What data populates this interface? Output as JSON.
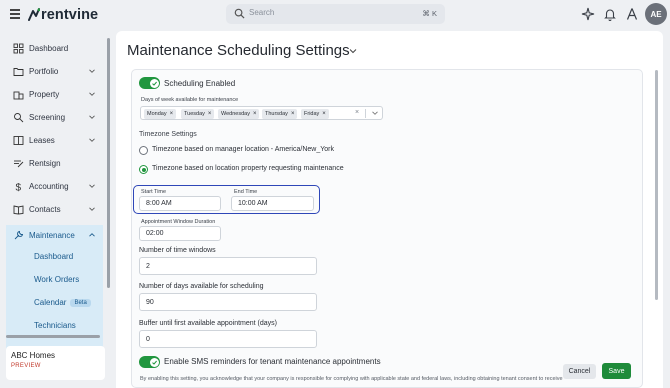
{
  "header": {
    "brand": "rentvine",
    "search_placeholder": "Search",
    "search_shortcut": "⌘ K",
    "avatar_initials": "AE"
  },
  "sidebar": {
    "items": [
      {
        "label": "Dashboard",
        "icon": "dashboard-icon"
      },
      {
        "label": "Portfolio",
        "icon": "portfolio-icon"
      },
      {
        "label": "Property",
        "icon": "property-icon"
      },
      {
        "label": "Screening",
        "icon": "screening-icon"
      },
      {
        "label": "Leases",
        "icon": "leases-icon"
      },
      {
        "label": "Rentsign",
        "icon": "rentsign-icon"
      },
      {
        "label": "Accounting",
        "icon": "accounting-icon"
      },
      {
        "label": "Contacts",
        "icon": "contacts-icon"
      },
      {
        "label": "Maintenance",
        "icon": "maintenance-icon"
      }
    ],
    "maintenance_sub": [
      {
        "label": "Dashboard"
      },
      {
        "label": "Work Orders"
      },
      {
        "label": "Calendar",
        "badge": "Beta"
      },
      {
        "label": "Technicians"
      }
    ],
    "company_name": "ABC Homes",
    "company_tag": "PREVIEW"
  },
  "page": {
    "title": "Maintenance Scheduling Settings"
  },
  "form": {
    "scheduling_enabled_label": "Scheduling Enabled",
    "days_label": "Days of week available for maintenance",
    "days": [
      "Monday",
      "Tuesday",
      "Wednesday",
      "Thursday",
      "Friday"
    ],
    "timezone_section": "Timezone Settings",
    "tz_option_manager": "Timezone based on manager location - America/New_York",
    "tz_option_property": "Timezone based on location property requesting maintenance",
    "start_time_label": "Start Time",
    "start_time_value": "8:00 AM",
    "end_time_label": "End Time",
    "end_time_value": "10:00 AM",
    "window_duration_label": "Appointment Window Duration",
    "window_duration_value": "02:00",
    "num_windows_label": "Number of time windows",
    "num_windows_value": "2",
    "num_days_label": "Number of days available for scheduling",
    "num_days_value": "90",
    "buffer_label": "Buffer until first available appointment (days)",
    "buffer_value": "0",
    "sms_label": "Enable SMS reminders for tenant maintenance appointments",
    "sms_help": "By enabling this setting, you acknowledge that your company is responsible for complying with applicable state and federal laws, including obtaining tenant consent to receive"
  },
  "actions": {
    "cancel": "Cancel",
    "save": "Save"
  },
  "colors": {
    "accent_green": "#21963f",
    "highlight_blue": "#2f47b8",
    "nav_active_bg": "#d8ebf7"
  }
}
